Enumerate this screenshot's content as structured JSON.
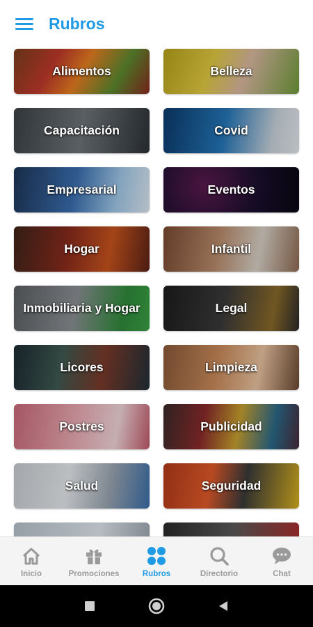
{
  "header": {
    "title": "Rubros",
    "menu_icon": "hamburger-menu-icon"
  },
  "categories": [
    {
      "label": "Alimentos",
      "bg": "linear-gradient(120deg,#7a3e1e 0%,#c0392b 30%,#e67e22 50%,#5d8a2f 75%,#8b2a1f 100%)"
    },
    {
      "label": "Belleza",
      "bg": "linear-gradient(110deg,#b7a31a 0%,#e0c840 35%,#d9b8a0 60%,#6f9a3a 100%)"
    },
    {
      "label": "Capacitación",
      "bg": "linear-gradient(100deg,#3b4147 0%,#6e7479 50%,#2d3236 100%)"
    },
    {
      "label": "Covid",
      "bg": "linear-gradient(100deg,#0c3a6b 0%,#2476b8 45%,#c9d3dc 80%,#e4e8ec 100%)"
    },
    {
      "label": "Empresarial",
      "bg": "linear-gradient(100deg,#1d3557 0%,#3a6fb0 45%,#9fc7e8 75%,#dde8f2 100%)"
    },
    {
      "label": "Eventos",
      "bg": "radial-gradient(circle at 30% 40%,#5a1a4f 0%,#1a0f2e 55%,#090611 100%)"
    },
    {
      "label": "Hogar",
      "bg": "linear-gradient(100deg,#3e2419 0%,#8a2b1d 40%,#c8541e 70%,#5b2216 100%)"
    },
    {
      "label": "Infantil",
      "bg": "linear-gradient(100deg,#7a4a32 0%,#b88a6a 40%,#d8d0c6 70%,#8f6b52 100%)"
    },
    {
      "label": "Inmobiliaria y Hogar",
      "bg": "linear-gradient(100deg,#5c5f63 0%,#8b8f93 45%,#2f8a3a 80%,#3aa046 100%)"
    },
    {
      "label": "Legal",
      "bg": "linear-gradient(100deg,#1c1c1c 0%,#3a3a3a 45%,#8a6a2a 80%,#2a2a2a 100%)"
    },
    {
      "label": "Licores",
      "bg": "linear-gradient(100deg,#1c2a30 0%,#3f5a52 35%,#7a3a2a 65%,#223038 100%)"
    },
    {
      "label": "Limpieza",
      "bg": "linear-gradient(100deg,#8a5a3a 0%,#c98a5a 40%,#e9c3a0 70%,#6b4a33 100%)"
    },
    {
      "label": "Postres",
      "bg": "linear-gradient(100deg,#c96a7a 0%,#e8a8b0 45%,#f1d5d8 75%,#c15a6a 100%)"
    },
    {
      "label": "Publicidad",
      "bg": "linear-gradient(100deg,#3a2a2a 0%,#8a2a2a 30%,#c8a030 55%,#2a6a8a 80%,#4a2a3a 100%)"
    },
    {
      "label": "Salud",
      "bg": "linear-gradient(100deg,#c8ccd1 0%,#e5e8eb 40%,#9aa5b1 70%,#3b6ea8 100%)"
    },
    {
      "label": "Seguridad",
      "bg": "linear-gradient(100deg,#b23a1a 0%,#e05a2a 35%,#3a3a3a 60%,#d8b020 100%)"
    },
    {
      "label": "",
      "bg": "linear-gradient(100deg,#b8c2cc 0%,#dfe6ed 60%,#9aa4ae 100%)"
    },
    {
      "label": "",
      "bg": "linear-gradient(100deg,#2a2a2a 0%,#5a5a5a 50%,#b02a2a 100%)"
    }
  ],
  "bottom_nav": [
    {
      "label": "Inicio",
      "icon": "home-icon",
      "active": false
    },
    {
      "label": "Promociones",
      "icon": "gift-icon",
      "active": false
    },
    {
      "label": "Rubros",
      "icon": "grid-dots-icon",
      "active": true
    },
    {
      "label": "Directorio",
      "icon": "search-icon",
      "active": false
    },
    {
      "label": "Chat",
      "icon": "chat-bubble-icon",
      "active": false
    }
  ],
  "colors": {
    "accent": "#1f9be6",
    "nav_inactive": "#9a9a9a"
  },
  "system_bar": {
    "buttons": [
      "recents-square-icon",
      "home-circle-icon",
      "back-triangle-icon"
    ]
  }
}
